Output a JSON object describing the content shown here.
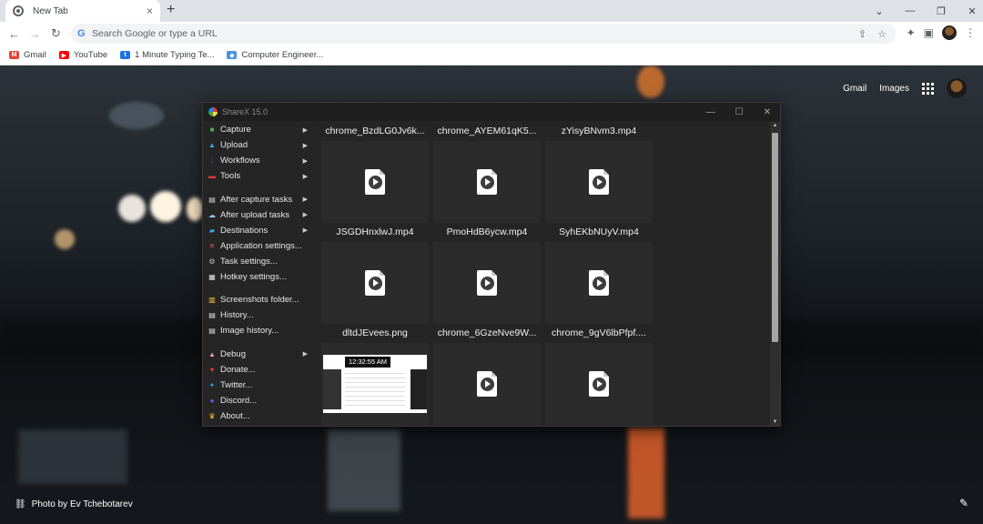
{
  "browser": {
    "tab_title": "New Tab",
    "tab_close": "×",
    "new_tab": "+",
    "window_controls": [
      "⌄",
      "—",
      "❐",
      "✕"
    ],
    "omnibox_placeholder": "Search Google or type a URL",
    "bookmarks": [
      {
        "label": "Gmail",
        "icon": "gmail-icon",
        "color": "#ea4335"
      },
      {
        "label": "YouTube",
        "icon": "youtube-icon",
        "color": "#ff0000"
      },
      {
        "label": "1 Minute Typing Te...",
        "icon": "typing-icon",
        "color": "#1a73e8"
      },
      {
        "label": "Computer Engineer...",
        "icon": "diamond-icon",
        "color": "#4a90e2"
      }
    ]
  },
  "ntp": {
    "gmail_link": "Gmail",
    "images_link": "Images",
    "photo_credit": "Photo by Ev Tchebotarev"
  },
  "sharex": {
    "title": "ShareX 15.0",
    "menu": [
      {
        "label": "Capture",
        "icon": "capture-icon",
        "color": "#4caf50",
        "submenu": true
      },
      {
        "label": "Upload",
        "icon": "upload-icon",
        "color": "#42a5f5",
        "submenu": true
      },
      {
        "label": "Workflows",
        "icon": "workflows-icon",
        "color": "#7e57c2",
        "submenu": true
      },
      {
        "label": "Tools",
        "icon": "tools-icon",
        "color": "#e53935",
        "submenu": true
      },
      {
        "label": "After capture tasks",
        "icon": "after-capture-icon",
        "color": "#cfd8dc",
        "submenu": true,
        "group_start": true
      },
      {
        "label": "After upload tasks",
        "icon": "after-upload-icon",
        "color": "#90caf9",
        "submenu": true
      },
      {
        "label": "Destinations",
        "icon": "destinations-icon",
        "color": "#29b6f6",
        "submenu": true
      },
      {
        "label": "Application settings...",
        "icon": "app-settings-icon",
        "color": "#ef5350",
        "submenu": false
      },
      {
        "label": "Task settings...",
        "icon": "task-settings-icon",
        "color": "#bdbdbd",
        "submenu": false
      },
      {
        "label": "Hotkey settings...",
        "icon": "hotkey-settings-icon",
        "color": "#e0e0e0",
        "submenu": false
      },
      {
        "label": "Screenshots folder...",
        "icon": "folder-icon",
        "color": "#ffca28",
        "submenu": false,
        "group_start": true
      },
      {
        "label": "History...",
        "icon": "history-icon",
        "color": "#e0e0e0",
        "submenu": false
      },
      {
        "label": "Image history...",
        "icon": "image-history-icon",
        "color": "#e0e0e0",
        "submenu": false
      },
      {
        "label": "Debug",
        "icon": "debug-icon",
        "color": "#ef9a9a",
        "submenu": true,
        "group_start": true
      },
      {
        "label": "Donate...",
        "icon": "heart-icon",
        "color": "#e53935",
        "submenu": false
      },
      {
        "label": "Twitter...",
        "icon": "twitter-icon",
        "color": "#1da1f2",
        "submenu": false
      },
      {
        "label": "Discord...",
        "icon": "discord-icon",
        "color": "#5865f2",
        "submenu": false
      },
      {
        "label": "About...",
        "icon": "crown-icon",
        "color": "#fbc02d",
        "submenu": false
      }
    ],
    "files": [
      {
        "name": "chrome_BzdLG0Jv6k...",
        "kind": "video"
      },
      {
        "name": "chrome_AYEM61qK5...",
        "kind": "video"
      },
      {
        "name": "zYisyBNvm3.mp4",
        "kind": "video"
      },
      {
        "name": "JSGDHnxlwJ.mp4",
        "kind": "video"
      },
      {
        "name": "PmoHdB6ycw.mp4",
        "kind": "video"
      },
      {
        "name": "SyhEKbNUyV.mp4",
        "kind": "video"
      },
      {
        "name": "dltdJEvees.png",
        "kind": "image",
        "thumb_text": "12:32:55 AM"
      },
      {
        "name": "chrome_6GzeNve9W...",
        "kind": "video"
      },
      {
        "name": "chrome_9gV6lbPfpf....",
        "kind": "video"
      }
    ]
  }
}
